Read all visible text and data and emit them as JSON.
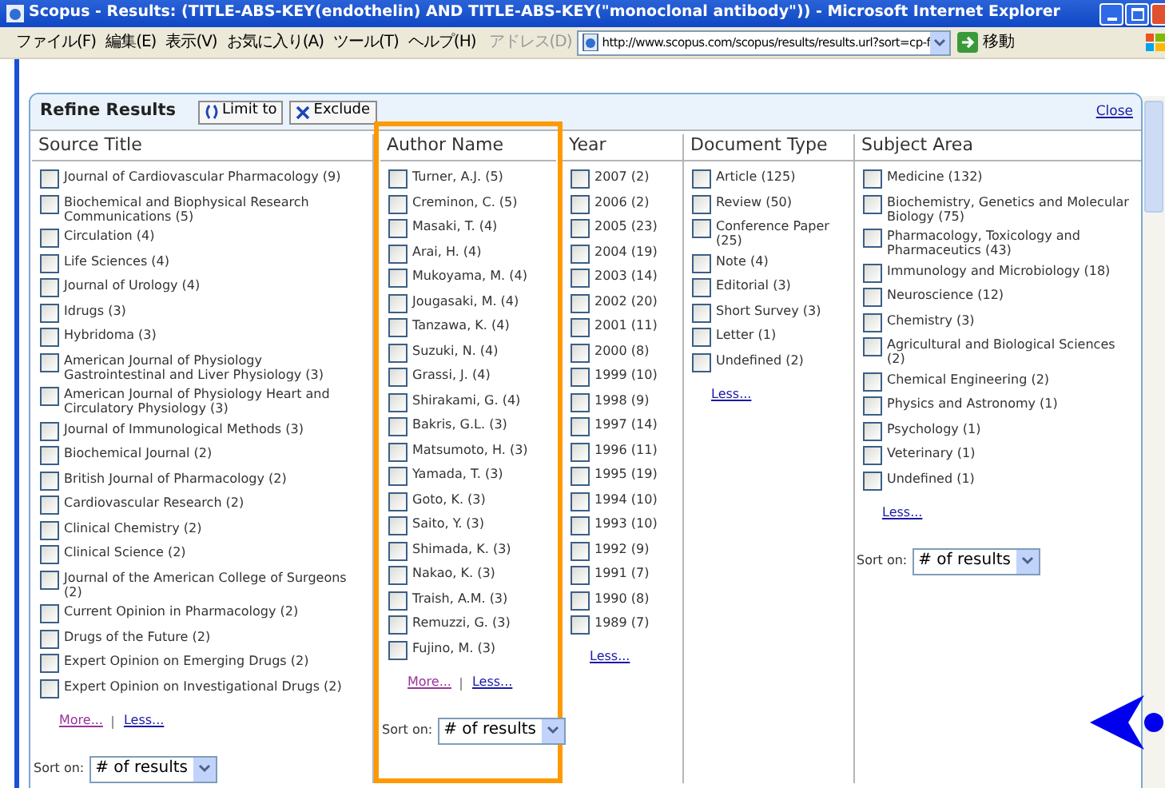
{
  "window": {
    "title": "Scopus - Results: (TITLE-ABS-KEY(endothelin) AND TITLE-ABS-KEY(\"monoclonal antibody\")) - Microsoft Internet Explorer"
  },
  "menu": [
    "ファイル(F)",
    "編集(E)",
    "表示(V)",
    "お気に入り(A)",
    "ツール(T)",
    "ヘルプ(H)"
  ],
  "address": {
    "label": "アドレス(D)",
    "url": "http://www.scopus.com/scopus/results/results.url?sort=cp-f",
    "go": "移動"
  },
  "panel": {
    "title": "Refine Results",
    "buttons": [
      {
        "label": "Limit to",
        "kind": "limit"
      },
      {
        "label": "Exclude",
        "kind": "exclude"
      }
    ],
    "close": "Close"
  },
  "columns": [
    {
      "header": "Source Title",
      "highlighted": false,
      "items": [
        {
          "label": "Journal of Cardiovascular Pharmacology (9)",
          "checked": false
        },
        {
          "label": "Biochemical and Biophysical Research Communications (5)",
          "checked": false
        },
        {
          "label": "Circulation (4)",
          "checked": false
        },
        {
          "label": "Life Sciences (4)",
          "checked": false
        },
        {
          "label": "Journal of Urology (4)",
          "checked": false
        },
        {
          "label": "Idrugs (3)",
          "checked": false
        },
        {
          "label": "Hybridoma (3)",
          "checked": false
        },
        {
          "label": "American Journal of Physiology Gastrointestinal and Liver Physiology (3)",
          "checked": false
        },
        {
          "label": "American Journal of Physiology Heart and Circulatory Physiology (3)",
          "checked": false
        },
        {
          "label": "Journal of Immunological Methods (3)",
          "checked": false
        },
        {
          "label": "Biochemical Journal (2)",
          "checked": false
        },
        {
          "label": "British Journal of Pharmacology (2)",
          "checked": false
        },
        {
          "label": "Cardiovascular Research (2)",
          "checked": false
        },
        {
          "label": "Clinical Chemistry (2)",
          "checked": false
        },
        {
          "label": "Clinical Science (2)",
          "checked": false
        },
        {
          "label": "Journal of the American College of Surgeons (2)",
          "checked": false
        },
        {
          "label": "Current Opinion in Pharmacology (2)",
          "checked": false
        },
        {
          "label": "Drugs of the Future (2)",
          "checked": false
        },
        {
          "label": "Expert Opinion on Emerging Drugs (2)",
          "checked": false
        },
        {
          "label": "Expert Opinion on Investigational Drugs (2)",
          "checked": false
        }
      ],
      "links": [
        {
          "label": "More...",
          "visited": true
        },
        {
          "label": "Less...",
          "visited": false
        }
      ],
      "sort": {
        "label": "Sort on:",
        "value": "# of results"
      }
    },
    {
      "header": "Author Name",
      "highlighted": true,
      "items": [
        {
          "label": "Turner, A.J. (5)",
          "checked": false
        },
        {
          "label": "Creminon, C. (5)",
          "checked": false
        },
        {
          "label": "Masaki, T. (4)",
          "checked": false
        },
        {
          "label": "Arai, H. (4)",
          "checked": false
        },
        {
          "label": "Mukoyama, M. (4)",
          "checked": false
        },
        {
          "label": "Jougasaki, M. (4)",
          "checked": false
        },
        {
          "label": "Tanzawa, K. (4)",
          "checked": false
        },
        {
          "label": "Suzuki, N. (4)",
          "checked": false
        },
        {
          "label": "Grassi, J. (4)",
          "checked": false
        },
        {
          "label": "Shirakami, G. (4)",
          "checked": false
        },
        {
          "label": "Bakris, G.L. (3)",
          "checked": false
        },
        {
          "label": "Matsumoto, H. (3)",
          "checked": false
        },
        {
          "label": "Yamada, T. (3)",
          "checked": false
        },
        {
          "label": "Goto, K. (3)",
          "checked": false
        },
        {
          "label": "Saito, Y. (3)",
          "checked": false
        },
        {
          "label": "Shimada, K. (3)",
          "checked": false
        },
        {
          "label": "Nakao, K. (3)",
          "checked": false
        },
        {
          "label": "Traish, A.M. (3)",
          "checked": false
        },
        {
          "label": "Remuzzi, G. (3)",
          "checked": false
        },
        {
          "label": "Fujino, M. (3)",
          "checked": false
        }
      ],
      "links": [
        {
          "label": "More...",
          "visited": true
        },
        {
          "label": "Less...",
          "visited": false
        }
      ],
      "sort": {
        "label": "Sort on:",
        "value": "# of results"
      }
    },
    {
      "header": "Year",
      "highlighted": false,
      "items": [
        {
          "label": "2007 (2)",
          "checked": false
        },
        {
          "label": "2006 (2)",
          "checked": false
        },
        {
          "label": "2005 (23)",
          "checked": false
        },
        {
          "label": "2004 (19)",
          "checked": false
        },
        {
          "label": "2003 (14)",
          "checked": false
        },
        {
          "label": "2002 (20)",
          "checked": false
        },
        {
          "label": "2001 (11)",
          "checked": false
        },
        {
          "label": "2000 (8)",
          "checked": false
        },
        {
          "label": "1999 (10)",
          "checked": false
        },
        {
          "label": "1998 (9)",
          "checked": false
        },
        {
          "label": "1997 (14)",
          "checked": false
        },
        {
          "label": "1996 (11)",
          "checked": false
        },
        {
          "label": "1995 (19)",
          "checked": false
        },
        {
          "label": "1994 (10)",
          "checked": false
        },
        {
          "label": "1993 (10)",
          "checked": false
        },
        {
          "label": "1992 (9)",
          "checked": false
        },
        {
          "label": "1991 (7)",
          "checked": false
        },
        {
          "label": "1990 (8)",
          "checked": false
        },
        {
          "label": "1989 (7)",
          "checked": false
        }
      ],
      "links": [
        {
          "label": "Less...",
          "visited": false
        }
      ]
    },
    {
      "header": "Document Type",
      "highlighted": false,
      "items": [
        {
          "label": "Article (125)",
          "checked": false
        },
        {
          "label": "Review (50)",
          "checked": false
        },
        {
          "label": "Conference Paper (25)",
          "checked": false
        },
        {
          "label": "Note (4)",
          "checked": false
        },
        {
          "label": "Editorial (3)",
          "checked": false
        },
        {
          "label": "Short Survey (3)",
          "checked": false
        },
        {
          "label": "Letter (1)",
          "checked": false
        },
        {
          "label": "Undefined (2)",
          "checked": false
        }
      ],
      "links": [
        {
          "label": "Less...",
          "visited": false
        }
      ]
    },
    {
      "header": "Subject Area",
      "highlighted": false,
      "items": [
        {
          "label": "Medicine (132)",
          "checked": false
        },
        {
          "label": "Biochemistry, Genetics and Molecular Biology (75)",
          "checked": false
        },
        {
          "label": "Pharmacology, Toxicology and Pharmaceutics (43)",
          "checked": false
        },
        {
          "label": "Immunology and Microbiology (18)",
          "checked": false
        },
        {
          "label": "Neuroscience (12)",
          "checked": false
        },
        {
          "label": "Chemistry (3)",
          "checked": false
        },
        {
          "label": "Agricultural and Biological Sciences (2)",
          "checked": false
        },
        {
          "label": "Chemical Engineering (2)",
          "checked": false
        },
        {
          "label": "Physics and Astronomy (1)",
          "checked": false
        },
        {
          "label": "Psychology (1)",
          "checked": false
        },
        {
          "label": "Veterinary (1)",
          "checked": false
        },
        {
          "label": "Undefined (1)",
          "checked": false
        }
      ],
      "links": [
        {
          "label": "Less...",
          "visited": false
        }
      ],
      "sort": {
        "label": "Sort on:",
        "value": "# of results"
      }
    }
  ]
}
